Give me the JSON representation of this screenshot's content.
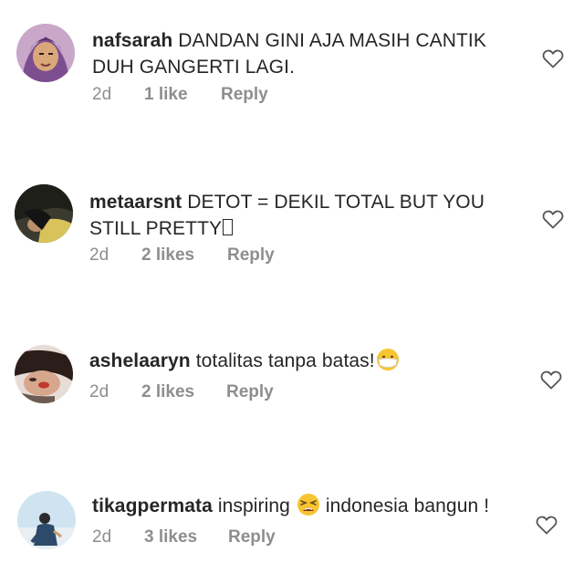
{
  "comments": [
    {
      "username": "nafsarah",
      "text": "DANDAN GINI AJA MASIH CANTIK DUH GANGERTI LAGI.",
      "time": "2d",
      "likes": "1 like",
      "reply": "Reply",
      "emoji": ""
    },
    {
      "username": "metaarsnt",
      "text": "DETOT = DEKIL TOTAL BUT YOU STILL PRETTY",
      "time": "2d",
      "likes": "2 likes",
      "reply": "Reply",
      "emoji": "unsupported-glyph-box"
    },
    {
      "username": "ashelaaryn",
      "text": "totalitas tanpa batas!",
      "time": "2d",
      "likes": "2 likes",
      "reply": "Reply",
      "emoji": "face-with-medical-mask-emoji"
    },
    {
      "username": "tikagpermata",
      "text": "inspiring",
      "text_after": "indonesia bangun !",
      "time": "2d",
      "likes": "3 likes",
      "reply": "Reply",
      "emoji": "tired-face-emoji"
    }
  ],
  "icons": {
    "like": "heart-outline-icon"
  },
  "colors": {
    "text": "#262626",
    "meta": "#8e8e8e",
    "background": "#ffffff"
  }
}
